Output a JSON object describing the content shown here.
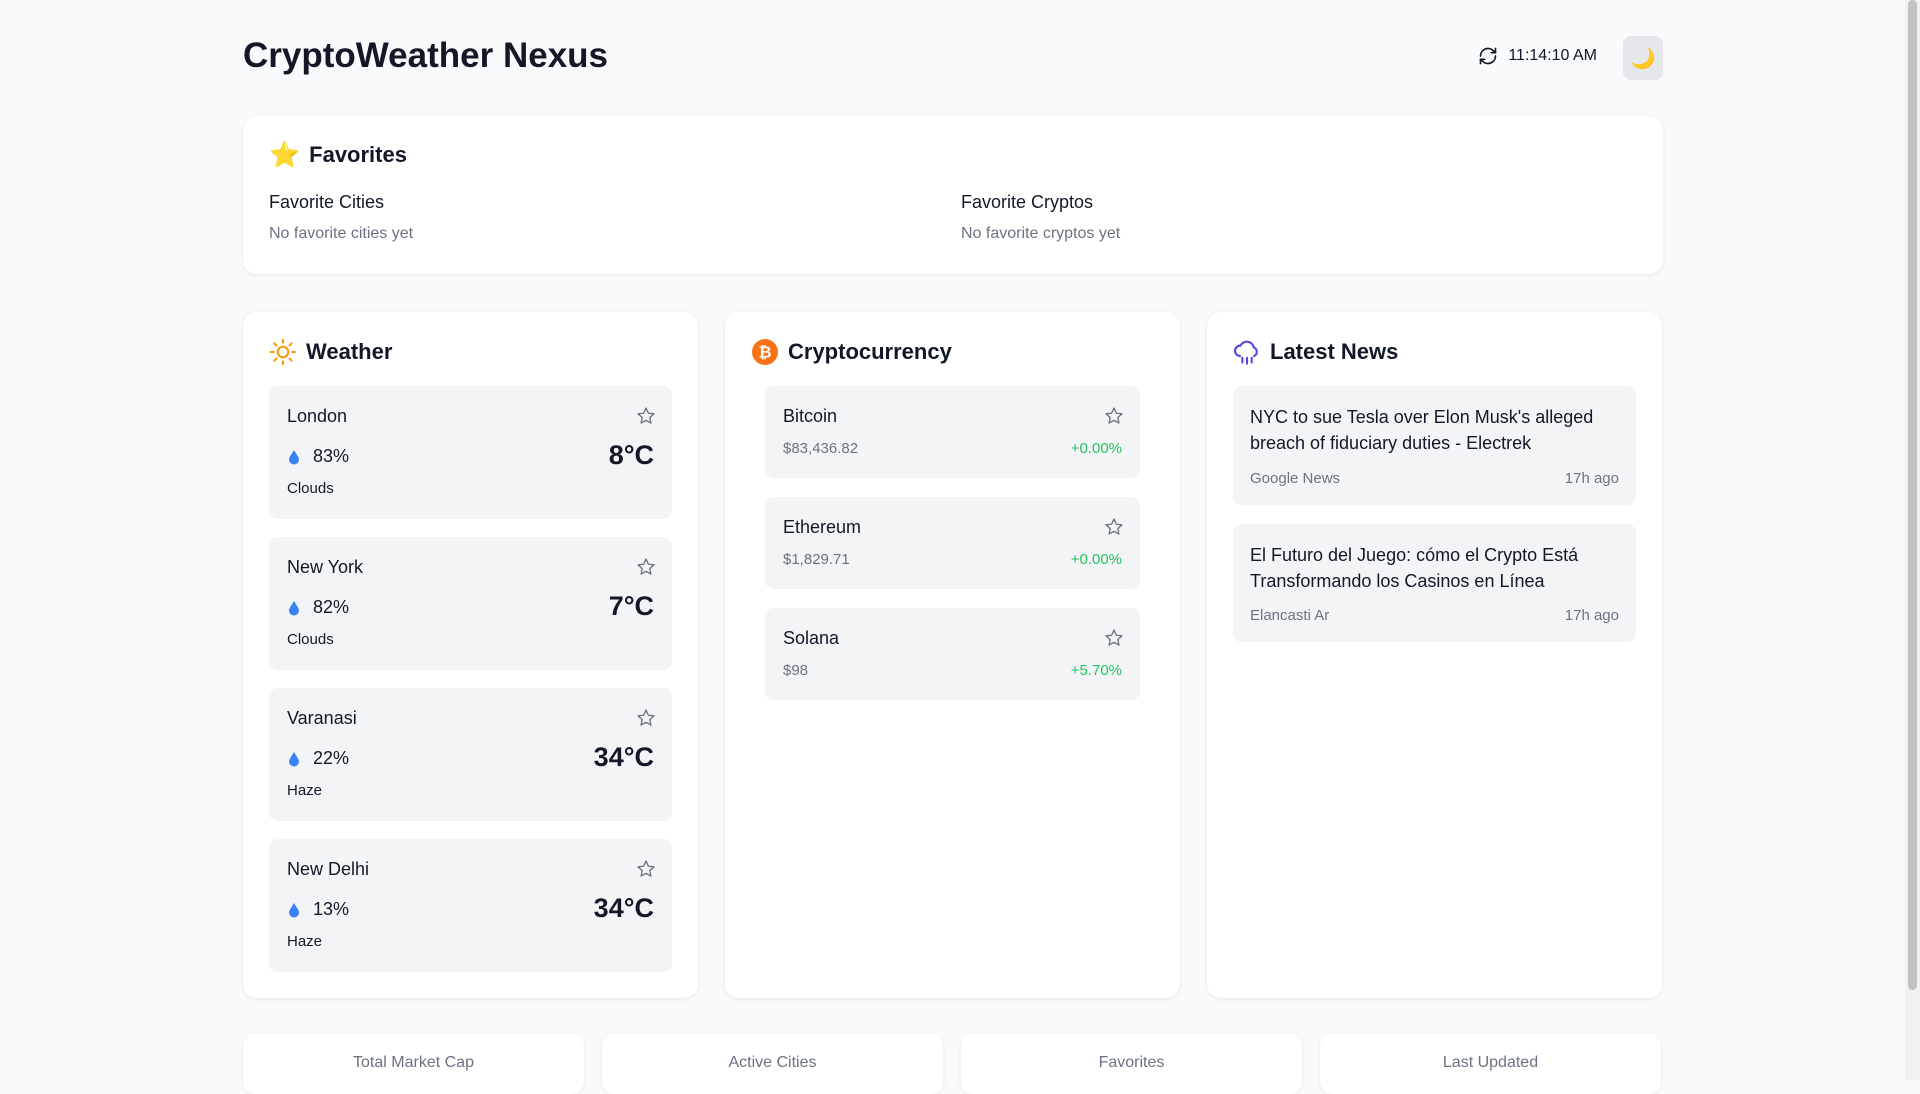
{
  "header": {
    "title": "CryptoWeather Nexus",
    "time": "11:14:10 AM",
    "refresh_icon": "refresh-icon",
    "theme_toggle_icon": "🌙"
  },
  "favorites": {
    "icon": "⭐",
    "title": "Favorites",
    "cities_heading": "Favorite Cities",
    "cities_empty": "No favorite cities yet",
    "cryptos_heading": "Favorite Cryptos",
    "cryptos_empty": "No favorite cryptos yet"
  },
  "weather": {
    "title": "Weather",
    "icon": "sun-icon",
    "cities": [
      {
        "name": "London",
        "humidity": "83%",
        "temp": "8°C",
        "condition": "Clouds"
      },
      {
        "name": "New York",
        "humidity": "82%",
        "temp": "7°C",
        "condition": "Clouds"
      },
      {
        "name": "Varanasi",
        "humidity": "22%",
        "temp": "34°C",
        "condition": "Haze"
      },
      {
        "name": "New Delhi",
        "humidity": "13%",
        "temp": "34°C",
        "condition": "Haze"
      }
    ]
  },
  "crypto": {
    "title": "Cryptocurrency",
    "icon": "bitcoin-icon",
    "coins": [
      {
        "name": "Bitcoin",
        "price": "$83,436.82",
        "change": "+0.00%"
      },
      {
        "name": "Ethereum",
        "price": "$1,829.71",
        "change": "+0.00%"
      },
      {
        "name": "Solana",
        "price": "$98",
        "change": "+5.70%"
      }
    ]
  },
  "news": {
    "title": "Latest News",
    "icon": "cloud-rain-icon",
    "items": [
      {
        "headline": "NYC to sue Tesla over Elon Musk's alleged breach of fiduciary duties - Electrek",
        "source": "Google News",
        "time": "17h ago"
      },
      {
        "headline": "El Futuro del Juego: cómo el Crypto Está Transformando los Casinos en Línea",
        "source": "Elancasti Ar",
        "time": "17h ago"
      }
    ]
  },
  "stats": {
    "labels": [
      "Total Market Cap",
      "Active Cities",
      "Favorites",
      "Last Updated"
    ]
  },
  "colors": {
    "background": "#f9fafb",
    "card": "#ffffff",
    "tile": "#f3f4f6",
    "positive": "#22c55e",
    "muted": "#6b7280",
    "bitcoin": "#f97316",
    "humidity_drop": "#3b82f6",
    "sun": "#f59e0b",
    "rain_cloud": "#4f46e5"
  }
}
